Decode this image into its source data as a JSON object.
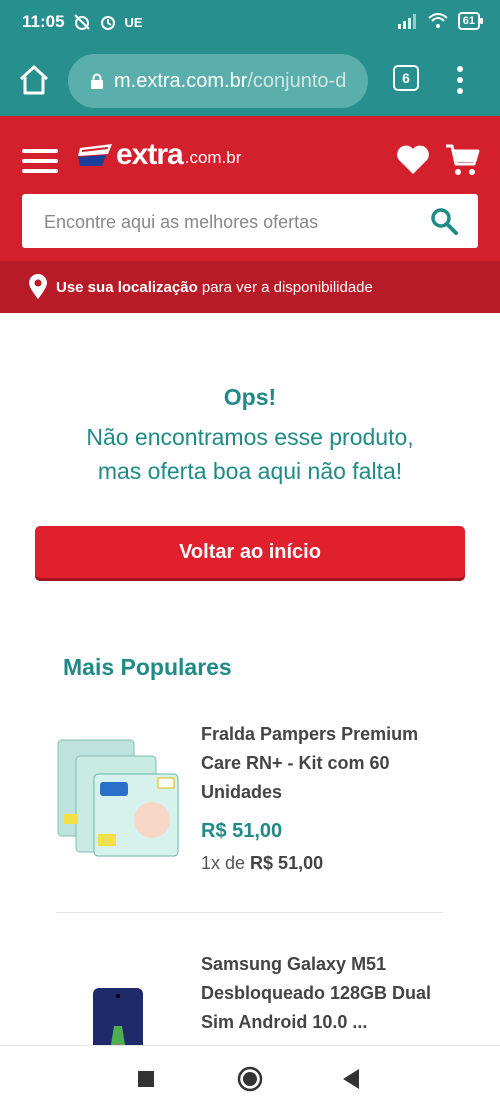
{
  "status_bar": {
    "time": "11:05",
    "carrier_tag": "UE",
    "battery": "61"
  },
  "browser": {
    "url_host": "m.extra.com.br",
    "url_path": "/conjunto-d",
    "tab_count": "6"
  },
  "site": {
    "logo_name": "extra",
    "logo_domain": ".com.br",
    "search_placeholder": "Encontre aqui as melhores ofertas",
    "location_bold": "Use sua localização",
    "location_rest": " para ver a disponibilidade",
    "brand_red": "#d3202c",
    "brand_teal": "#1f8a86"
  },
  "error": {
    "title": "Ops!",
    "line1": "Não encontramos esse produto,",
    "line2": "mas oferta boa aqui não falta!",
    "back_button": "Voltar ao início"
  },
  "popular": {
    "title": "Mais Populares",
    "items": [
      {
        "name": "Fralda Pampers Premium Care RN+ - Kit com 60 Unidades",
        "price": "R$ 51,00",
        "installment_prefix": "1x de ",
        "installment_value": "R$ 51,00",
        "icon": "diaper-pack-image"
      },
      {
        "name": "Samsung Galaxy M51 Desbloqueado 128GB Dual Sim Android 10.0 ...",
        "icon": "smartphone-image"
      }
    ]
  }
}
